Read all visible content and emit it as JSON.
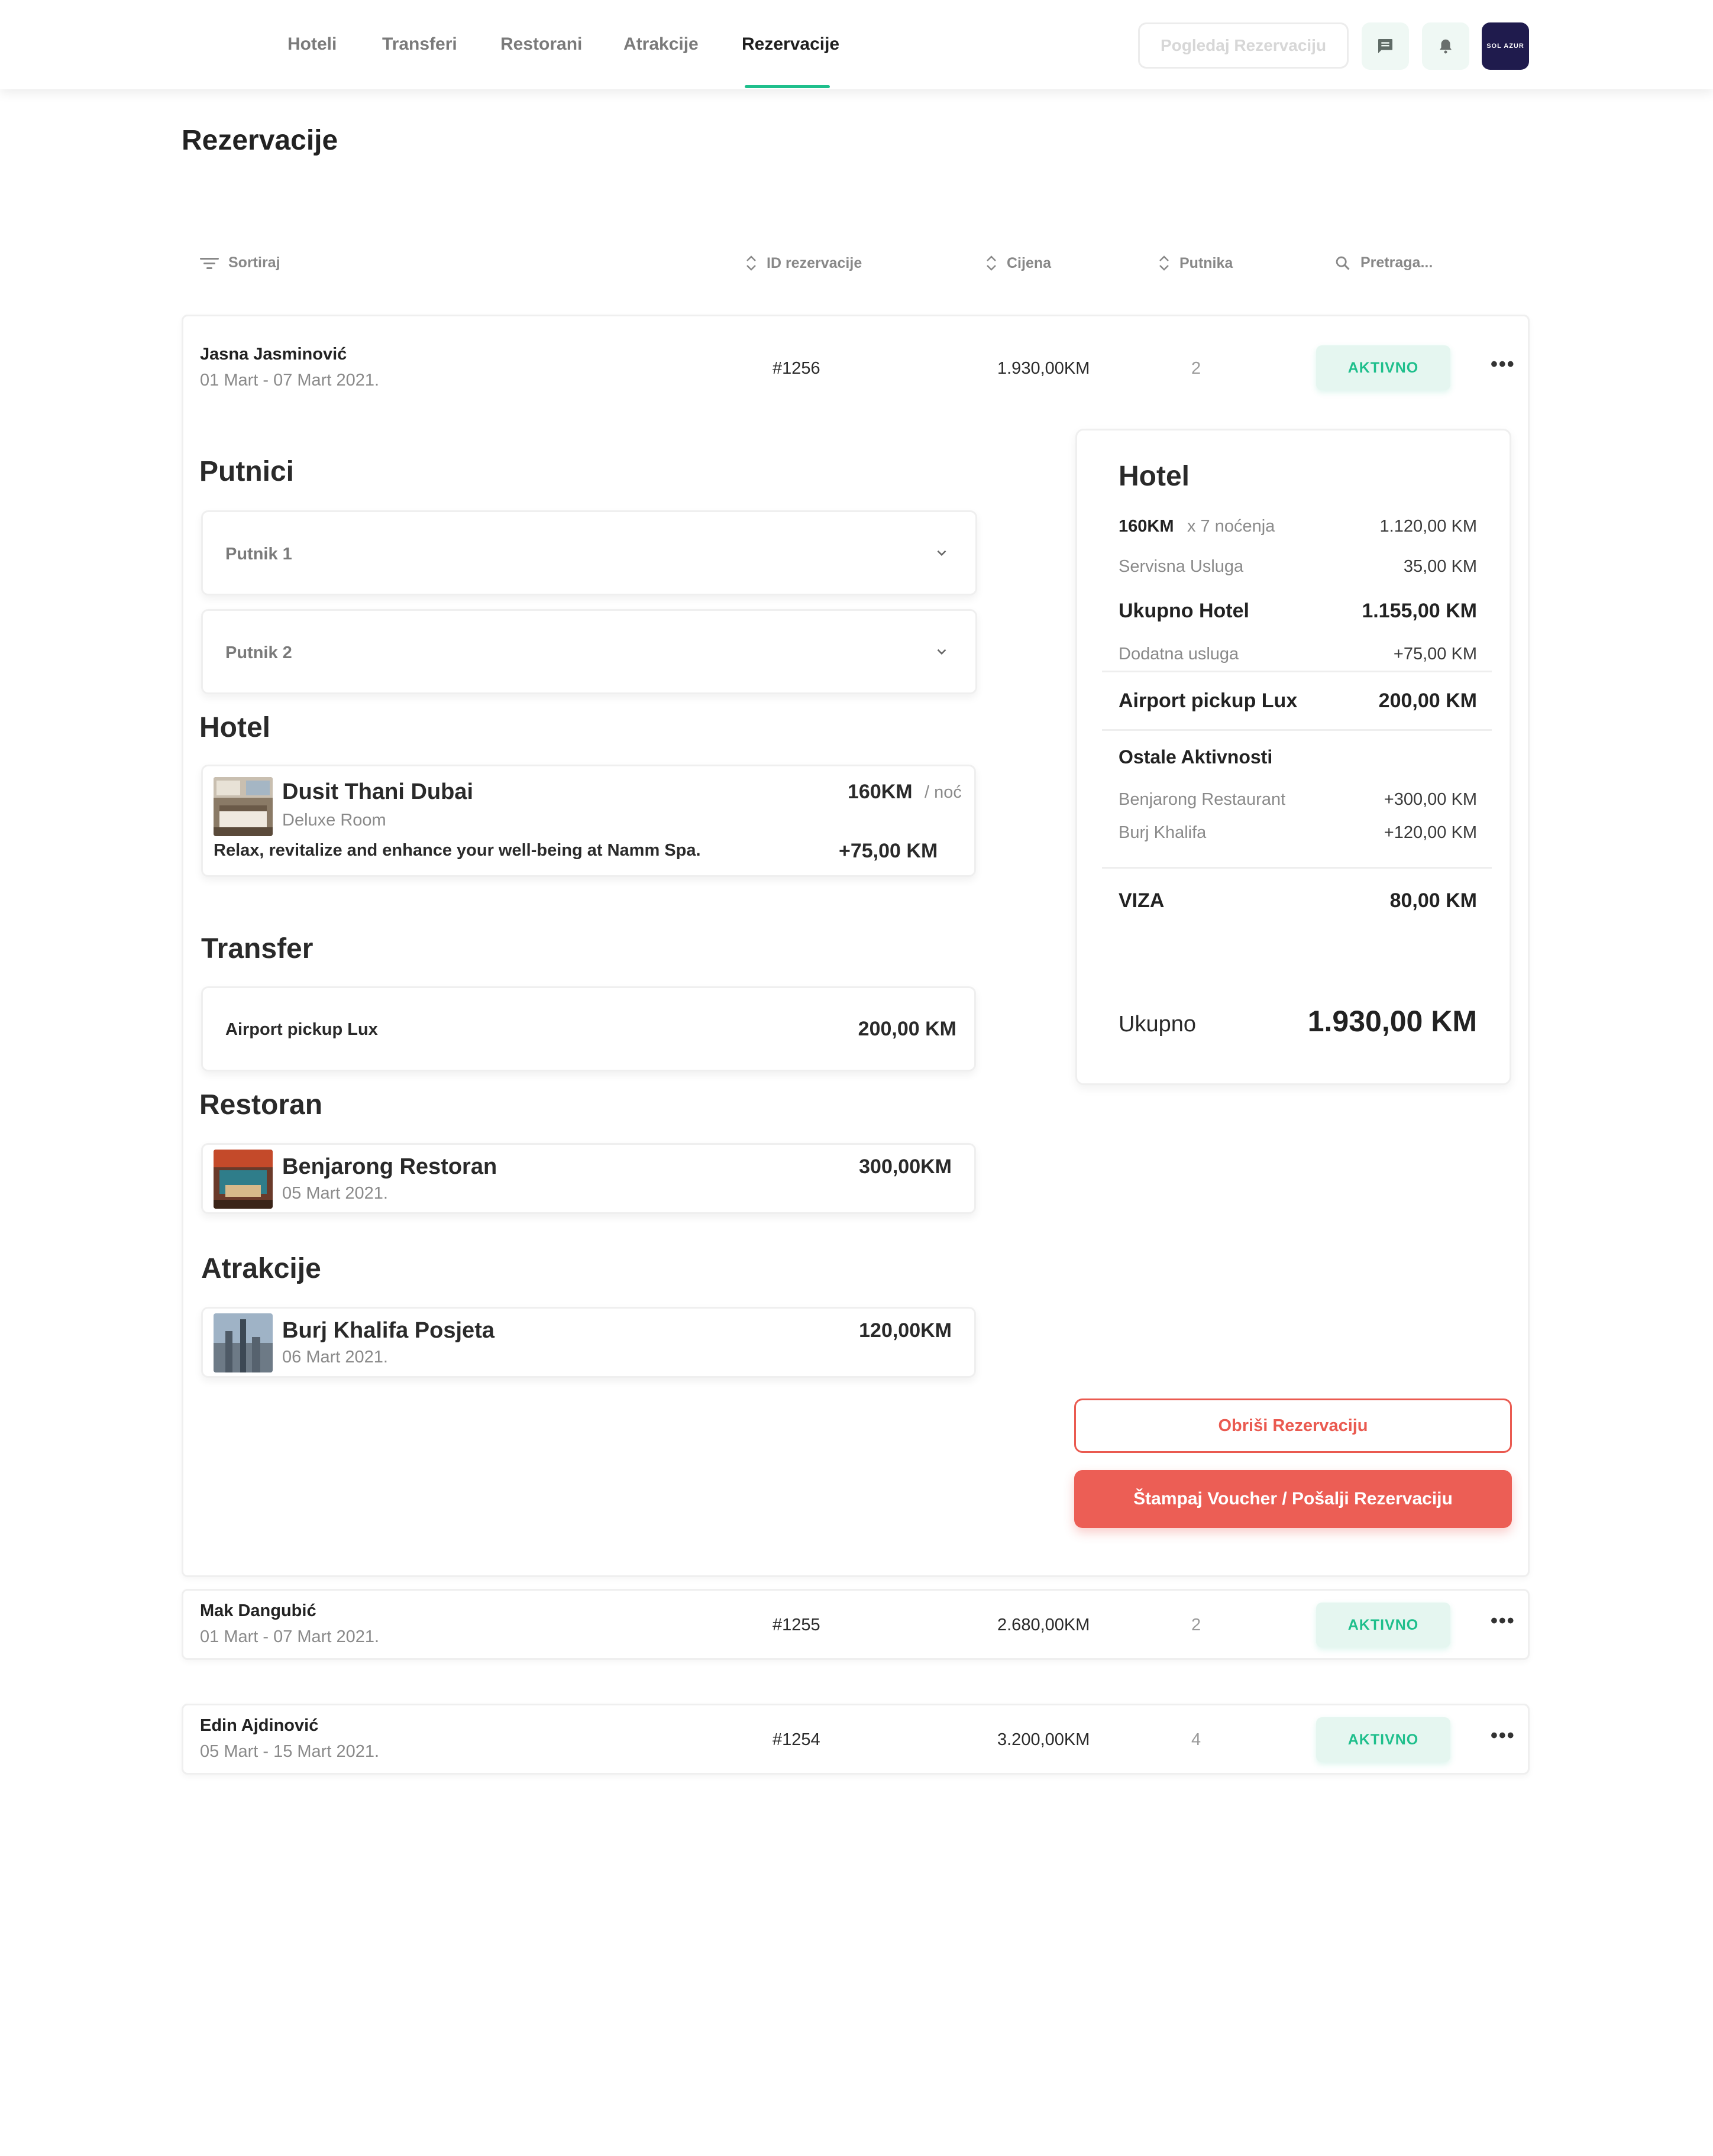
{
  "nav": {
    "tabs": [
      {
        "label": "Hoteli"
      },
      {
        "label": "Transferi"
      },
      {
        "label": "Restorani"
      },
      {
        "label": "Atrakcije"
      },
      {
        "label": "Rezervacije",
        "active": true
      }
    ],
    "view_button": "Pogledaj Rezervaciju",
    "messages_icon": "chat-icon",
    "notifications_icon": "bell-icon",
    "avatar_text": "SOL AZUR"
  },
  "page": {
    "title": "Rezervacije"
  },
  "list_header": {
    "sort": "Sortiraj",
    "id": "ID rezervacije",
    "price": "Cijena",
    "guests": "Putnika",
    "search_placeholder": "Pretraga..."
  },
  "reservations": [
    {
      "name": "Jasna Jasminović",
      "dates": "01 Mart - 07 Mart 2021.",
      "id": "#1256",
      "price": "1.930,00KM",
      "guests": "2",
      "status": "AKTIVNO",
      "more": "•••"
    },
    {
      "name": "Mak Dangubić",
      "dates": "01 Mart - 07 Mart 2021.",
      "id": "#1255",
      "price": "2.680,00KM",
      "guests": "2",
      "status": "AKTIVNO",
      "more": "•••"
    },
    {
      "name": "Edin Ajdinović",
      "dates": "05 Mart - 15 Mart 2021.",
      "id": "#1254",
      "price": "3.200,00KM",
      "guests": "4",
      "status": "AKTIVNO",
      "more": "•••"
    }
  ],
  "details": {
    "passengers_title": "Putnici",
    "passengers": [
      {
        "label": "Putnik 1"
      },
      {
        "label": "Putnik 2"
      }
    ],
    "hotel_title": "Hotel",
    "hotel": {
      "name": "Dusit Thani Dubai",
      "room": "Deluxe Room",
      "price": "160KM",
      "per": "/ noć",
      "extra_text": "Relax, revitalize and enhance your well-being at Namm Spa.",
      "extra_price": "+75,00 KM"
    },
    "transfer_title": "Transfer",
    "transfer": {
      "name": "Airport pickup Lux",
      "price": "200,00 KM"
    },
    "restaurant_title": "Restoran",
    "restaurant": {
      "name": "Benjarong Restoran",
      "date": "05 Mart 2021.",
      "price": "300,00KM"
    },
    "attractions_title": "Atrakcije",
    "attraction": {
      "name": "Burj Khalifa Posjeta",
      "date": "06 Mart 2021.",
      "price": "120,00KM"
    }
  },
  "summary": {
    "title": "Hotel",
    "rate": "160KM",
    "nights": "x 7 noćenja",
    "rate_total": "1.120,00 KM",
    "service_label": "Servisna Usluga",
    "service_value": "35,00 KM",
    "hotel_total_label": "Ukupno Hotel",
    "hotel_total_value": "1.155,00 KM",
    "extra_label": "Dodatna usluga",
    "extra_value": "+75,00 KM",
    "transfer_label": "Airport pickup Lux",
    "transfer_value": "200,00 KM",
    "other_title": "Ostale Aktivnosti",
    "other": [
      {
        "label": "Benjarong Restaurant",
        "value": "+300,00 KM"
      },
      {
        "label": "Burj Khalifa",
        "value": "+120,00 KM"
      }
    ],
    "visa_label": "VIZA",
    "visa_value": "80,00 KM",
    "total_label": "Ukupno",
    "total_value": "1.930,00 KM"
  },
  "actions": {
    "delete": "Obriši Rezervaciju",
    "print": "Štampaj Voucher / Pošalji Rezervaciju"
  },
  "colors": {
    "accent": "#1fbf8c",
    "danger": "#ec5e55",
    "avatar_bg": "#1f1b4d"
  }
}
